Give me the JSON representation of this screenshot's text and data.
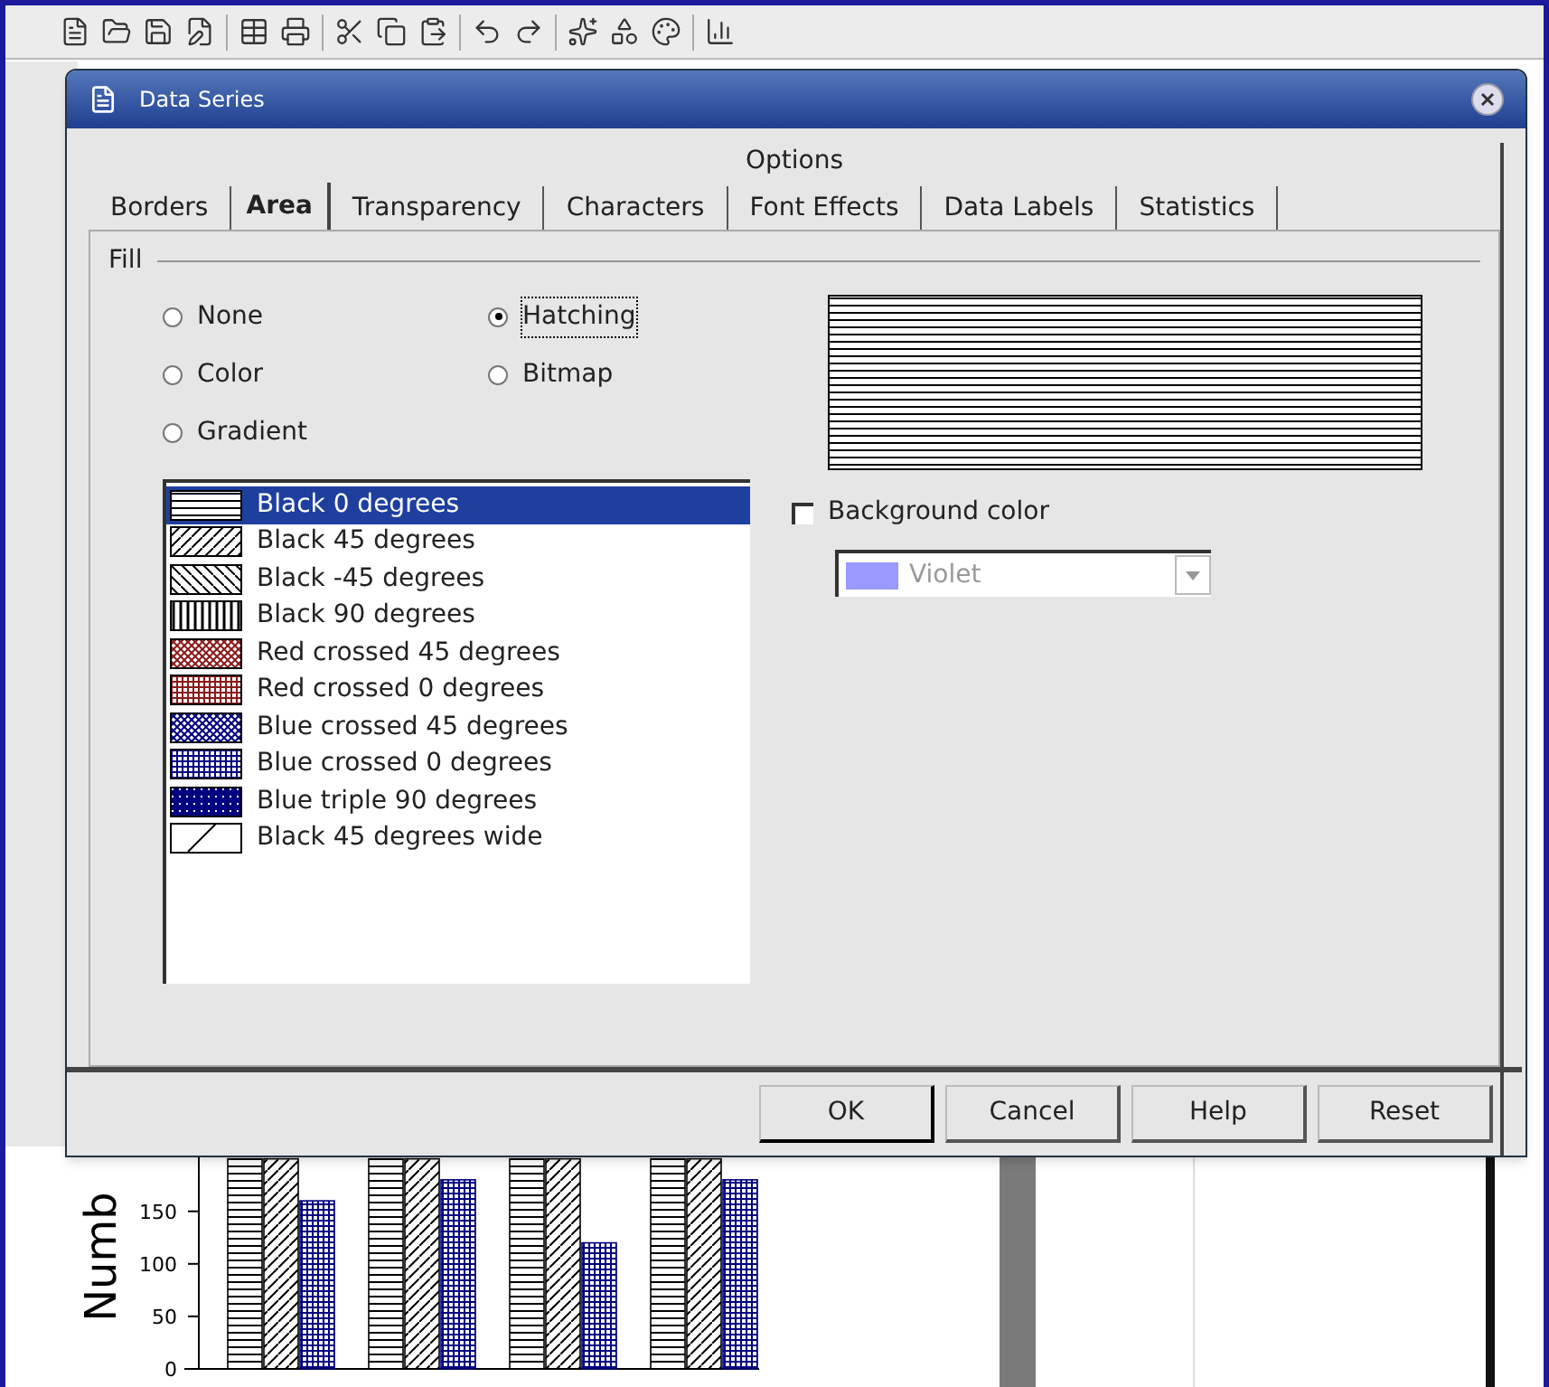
{
  "dialog": {
    "title": "Data Series"
  },
  "options_heading": "Options",
  "tabs": [
    {
      "label": "Borders",
      "selected": false
    },
    {
      "label": "Area",
      "selected": true
    },
    {
      "label": "Transparency",
      "selected": false
    },
    {
      "label": "Characters",
      "selected": false
    },
    {
      "label": "Font Effects",
      "selected": false
    },
    {
      "label": "Data Labels",
      "selected": false
    },
    {
      "label": "Statistics",
      "selected": false
    }
  ],
  "fill": {
    "label": "Fill",
    "options": [
      {
        "label": "None",
        "selected": false
      },
      {
        "label": "Color",
        "selected": false
      },
      {
        "label": "Gradient",
        "selected": false
      },
      {
        "label": "Hatching",
        "selected": true
      },
      {
        "label": "Bitmap",
        "selected": false
      }
    ]
  },
  "hatchings": [
    {
      "label": "Black 0 degrees",
      "kind": "h0",
      "color": "#000000",
      "selected": true
    },
    {
      "label": "Black 45 degrees",
      "kind": "d45",
      "color": "#000000",
      "selected": false
    },
    {
      "label": "Black -45 degrees",
      "kind": "dm45",
      "color": "#000000",
      "selected": false
    },
    {
      "label": "Black 90 degrees",
      "kind": "v90",
      "color": "#000000",
      "selected": false
    },
    {
      "label": "Red crossed 45 degrees",
      "kind": "x45",
      "color": "#8b1a1a",
      "selected": false
    },
    {
      "label": "Red crossed 0 degrees",
      "kind": "x0",
      "color": "#8b1a1a",
      "selected": false
    },
    {
      "label": "Blue crossed 45 degrees",
      "kind": "x45",
      "color": "#000080",
      "selected": false
    },
    {
      "label": "Blue crossed 0 degrees",
      "kind": "x0",
      "color": "#000080",
      "selected": false
    },
    {
      "label": "Blue triple 90 degrees",
      "kind": "t90",
      "color": "#000080",
      "selected": false
    },
    {
      "label": "Black 45 degrees wide",
      "kind": "w45",
      "color": "#000000",
      "selected": false
    }
  ],
  "background_color": {
    "label": "Background color",
    "checked": false,
    "value": "Violet",
    "color": "#9999ff",
    "disabled": true
  },
  "buttons": [
    {
      "label": "OK",
      "default": true
    },
    {
      "label": "Cancel",
      "default": false
    },
    {
      "label": "Help",
      "default": false
    },
    {
      "label": "Reset",
      "default": false
    }
  ],
  "chart": {
    "chart_data": {
      "type": "bar",
      "ylabel": "Numb",
      "ylim": [
        0,
        210
      ],
      "yticks": [
        0,
        50,
        100,
        150
      ],
      "series": [
        {
          "color": "#000000",
          "values": [
            200,
            200,
            200,
            200
          ]
        },
        {
          "color": "#000000",
          "values": [
            200,
            200,
            200,
            200
          ]
        },
        {
          "color": "#000080",
          "values": [
            160,
            180,
            120,
            180
          ]
        }
      ]
    }
  }
}
